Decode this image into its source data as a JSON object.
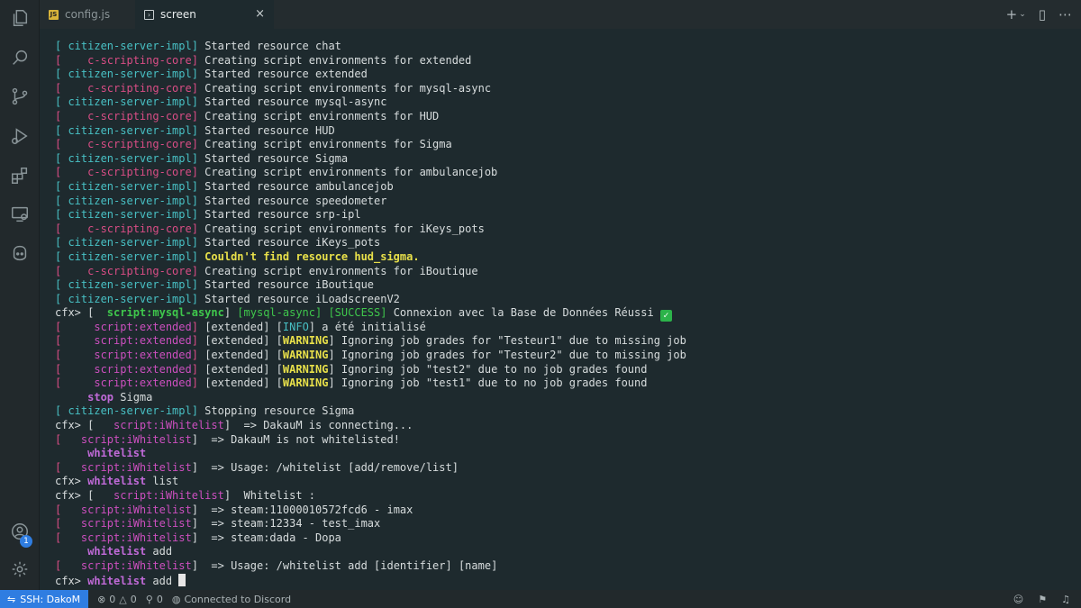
{
  "tabs": [
    {
      "label": "config.js",
      "icon": "js-file-icon"
    },
    {
      "label": "screen",
      "icon": "terminal-icon",
      "close": "×"
    }
  ],
  "tab_actions": {
    "new": "+",
    "split": "▯",
    "more": "⋯"
  },
  "activity": {
    "accounts_badge": "1"
  },
  "terminal_lines": [
    [
      {
        "t": "[ ",
        "c": "c-cyan"
      },
      {
        "t": "citizen-server-impl",
        "c": "c-cyan"
      },
      {
        "t": "] ",
        "c": "c-cyan"
      },
      {
        "t": "Started resource chat",
        "c": "c-white"
      }
    ],
    [
      {
        "t": "[    ",
        "c": "c-mag"
      },
      {
        "t": "c-scripting-core",
        "c": "c-mag"
      },
      {
        "t": "] ",
        "c": "c-mag"
      },
      {
        "t": "Creating script environments for extended",
        "c": "c-white"
      }
    ],
    [
      {
        "t": "[ citizen-server-impl] ",
        "c": "c-cyan"
      },
      {
        "t": "Started resource extended",
        "c": "c-white"
      }
    ],
    [
      {
        "t": "[    c-scripting-core] ",
        "c": "c-mag"
      },
      {
        "t": "Creating script environments for mysql-async",
        "c": "c-white"
      }
    ],
    [
      {
        "t": "[ citizen-server-impl] ",
        "c": "c-cyan"
      },
      {
        "t": "Started resource mysql-async",
        "c": "c-white"
      }
    ],
    [
      {
        "t": "[    c-scripting-core] ",
        "c": "c-mag"
      },
      {
        "t": "Creating script environments for HUD",
        "c": "c-white"
      }
    ],
    [
      {
        "t": "[ citizen-server-impl] ",
        "c": "c-cyan"
      },
      {
        "t": "Started resource HUD",
        "c": "c-white"
      }
    ],
    [
      {
        "t": "[    c-scripting-core] ",
        "c": "c-mag"
      },
      {
        "t": "Creating script environments for Sigma",
        "c": "c-white"
      }
    ],
    [
      {
        "t": "[ citizen-server-impl] ",
        "c": "c-cyan"
      },
      {
        "t": "Started resource Sigma",
        "c": "c-white"
      }
    ],
    [
      {
        "t": "[    c-scripting-core] ",
        "c": "c-mag"
      },
      {
        "t": "Creating script environments for ambulancejob",
        "c": "c-white"
      }
    ],
    [
      {
        "t": "[ citizen-server-impl] ",
        "c": "c-cyan"
      },
      {
        "t": "Started resource ambulancejob",
        "c": "c-white"
      }
    ],
    [
      {
        "t": "[ citizen-server-impl] ",
        "c": "c-cyan"
      },
      {
        "t": "Started resource speedometer",
        "c": "c-white"
      }
    ],
    [
      {
        "t": "[ citizen-server-impl] ",
        "c": "c-cyan"
      },
      {
        "t": "Started resource srp-ipl",
        "c": "c-white"
      }
    ],
    [
      {
        "t": "[    c-scripting-core] ",
        "c": "c-mag"
      },
      {
        "t": "Creating script environments for iKeys_pots",
        "c": "c-white"
      }
    ],
    [
      {
        "t": "[ citizen-server-impl] ",
        "c": "c-cyan"
      },
      {
        "t": "Started resource iKeys_pots",
        "c": "c-white"
      }
    ],
    [
      {
        "t": "[ citizen-server-impl] ",
        "c": "c-cyan"
      },
      {
        "t": "Couldn't find resource hud_sigma.",
        "c": "c-yellow c-bold"
      }
    ],
    [
      {
        "t": "[    c-scripting-core] ",
        "c": "c-mag"
      },
      {
        "t": "Creating script environments for iBoutique",
        "c": "c-white"
      }
    ],
    [
      {
        "t": "[ citizen-server-impl] ",
        "c": "c-cyan"
      },
      {
        "t": "Started resource iBoutique",
        "c": "c-white"
      }
    ],
    [
      {
        "t": "[ citizen-server-impl] ",
        "c": "c-cyan"
      },
      {
        "t": "Started resource iLoadscreenV2",
        "c": "c-white"
      }
    ],
    [
      {
        "t": "cfx> [  ",
        "c": "c-white"
      },
      {
        "t": "script:mysql-async",
        "c": "c-green c-bold"
      },
      {
        "t": "] ",
        "c": "c-white"
      },
      {
        "t": "[mysql-async] [SUCCESS] ",
        "c": "c-green"
      },
      {
        "t": "Connexion avec la Base de Données Réussi ",
        "c": "c-white"
      },
      {
        "t": "✓",
        "c": "check"
      }
    ],
    [
      {
        "t": "[     ",
        "c": "c-mag"
      },
      {
        "t": "script:extended",
        "c": "c-pink"
      },
      {
        "t": "] ",
        "c": "c-mag"
      },
      {
        "t": "[extended] [",
        "c": "c-white"
      },
      {
        "t": "INFO",
        "c": "c-cyan"
      },
      {
        "t": "] a été initialisé",
        "c": "c-white"
      }
    ],
    [
      {
        "t": "[     ",
        "c": "c-mag"
      },
      {
        "t": "script:extended",
        "c": "c-pink"
      },
      {
        "t": "] ",
        "c": "c-mag"
      },
      {
        "t": "[extended] [",
        "c": "c-white"
      },
      {
        "t": "WARNING",
        "c": "c-yellow c-bold"
      },
      {
        "t": "] Ignoring job grades for \"Testeur1\" due to missing job",
        "c": "c-white"
      }
    ],
    [
      {
        "t": "[     ",
        "c": "c-mag"
      },
      {
        "t": "script:extended",
        "c": "c-pink"
      },
      {
        "t": "] ",
        "c": "c-mag"
      },
      {
        "t": "[extended] [",
        "c": "c-white"
      },
      {
        "t": "WARNING",
        "c": "c-yellow c-bold"
      },
      {
        "t": "] Ignoring job grades for \"Testeur2\" due to missing job",
        "c": "c-white"
      }
    ],
    [
      {
        "t": "[     ",
        "c": "c-mag"
      },
      {
        "t": "script:extended",
        "c": "c-pink"
      },
      {
        "t": "] ",
        "c": "c-mag"
      },
      {
        "t": "[extended] [",
        "c": "c-white"
      },
      {
        "t": "WARNING",
        "c": "c-yellow c-bold"
      },
      {
        "t": "] Ignoring job \"test2\" due to no job grades found",
        "c": "c-white"
      }
    ],
    [
      {
        "t": "[     ",
        "c": "c-mag"
      },
      {
        "t": "script:extended",
        "c": "c-pink"
      },
      {
        "t": "] ",
        "c": "c-mag"
      },
      {
        "t": "[extended] [",
        "c": "c-white"
      },
      {
        "t": "WARNING",
        "c": "c-yellow c-bold"
      },
      {
        "t": "] Ignoring job \"test1\" due to no job grades found",
        "c": "c-white"
      }
    ],
    [
      {
        "t": "     ",
        "c": "c-white"
      },
      {
        "t": "stop",
        "c": "c-purple"
      },
      {
        "t": " Sigma",
        "c": "c-white"
      }
    ],
    [
      {
        "t": "[ citizen-server-impl] ",
        "c": "c-cyan"
      },
      {
        "t": "Stopping resource Sigma",
        "c": "c-white"
      }
    ],
    [
      {
        "t": "cfx> [   ",
        "c": "c-white"
      },
      {
        "t": "script:iWhitelist",
        "c": "c-pink"
      },
      {
        "t": "]  => DakauM is connecting...",
        "c": "c-white"
      }
    ],
    [
      {
        "t": "[   ",
        "c": "c-mag"
      },
      {
        "t": "script:iWhitelist",
        "c": "c-pink"
      },
      {
        "t": "]  => DakauM is not whitelisted!",
        "c": "c-white"
      }
    ],
    [
      {
        "t": "     ",
        "c": "c-white"
      },
      {
        "t": "whitelist",
        "c": "c-purple"
      }
    ],
    [
      {
        "t": "[   ",
        "c": "c-mag"
      },
      {
        "t": "script:iWhitelist",
        "c": "c-pink"
      },
      {
        "t": "]  => Usage: /whitelist [add/remove/list]",
        "c": "c-white"
      }
    ],
    [
      {
        "t": "cfx> ",
        "c": "c-white"
      },
      {
        "t": "whitelist",
        "c": "c-purple"
      },
      {
        "t": " list",
        "c": "c-white"
      }
    ],
    [
      {
        "t": "cfx> [   ",
        "c": "c-white"
      },
      {
        "t": "script:iWhitelist",
        "c": "c-pink"
      },
      {
        "t": "]  Whitelist :",
        "c": "c-white"
      }
    ],
    [
      {
        "t": "[   ",
        "c": "c-mag"
      },
      {
        "t": "script:iWhitelist",
        "c": "c-pink"
      },
      {
        "t": "]  => steam:11000010572fcd6 - imax",
        "c": "c-white"
      }
    ],
    [
      {
        "t": "[   ",
        "c": "c-mag"
      },
      {
        "t": "script:iWhitelist",
        "c": "c-pink"
      },
      {
        "t": "]  => steam:12334 - test_imax",
        "c": "c-white"
      }
    ],
    [
      {
        "t": "[   ",
        "c": "c-mag"
      },
      {
        "t": "script:iWhitelist",
        "c": "c-pink"
      },
      {
        "t": "]  => steam:dada - Dopa",
        "c": "c-white"
      }
    ],
    [
      {
        "t": "     ",
        "c": "c-white"
      },
      {
        "t": "whitelist",
        "c": "c-purple"
      },
      {
        "t": " add",
        "c": "c-white"
      }
    ],
    [
      {
        "t": "[   ",
        "c": "c-mag"
      },
      {
        "t": "script:iWhitelist",
        "c": "c-pink"
      },
      {
        "t": "]  => Usage: /whitelist add [identifier] [name]",
        "c": "c-white"
      }
    ],
    [
      {
        "t": "cfx> ",
        "c": "c-white"
      },
      {
        "t": "whitelist",
        "c": "c-purple"
      },
      {
        "t": " add ",
        "c": "c-white"
      },
      {
        "t": "",
        "c": "cursor"
      }
    ]
  ],
  "statusbar": {
    "ssh": "SSH: DakoM",
    "errors": "0",
    "warnings": "0",
    "ports": "0",
    "discord": "Connected to Discord"
  }
}
